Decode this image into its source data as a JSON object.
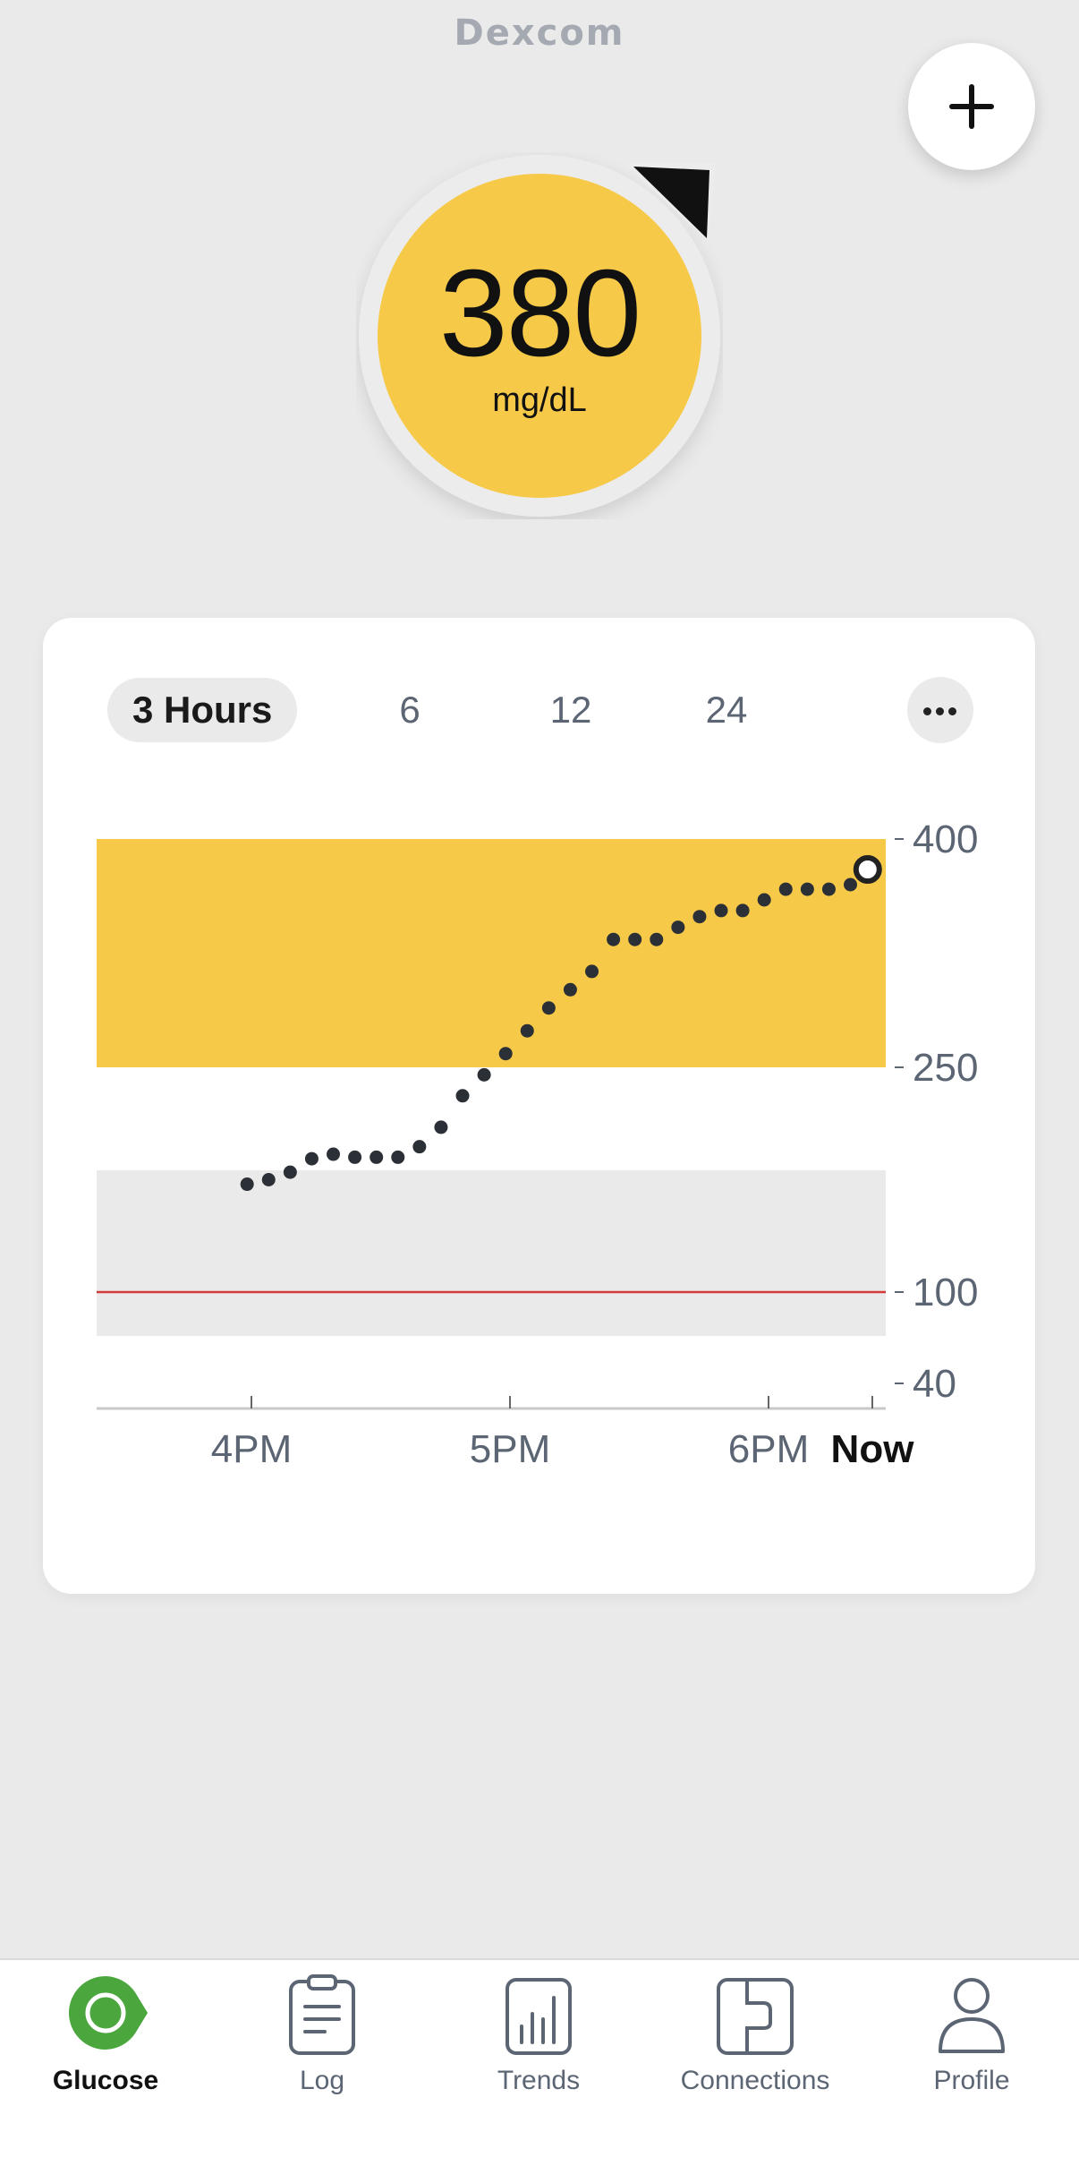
{
  "header": {
    "logo": "Dexcom",
    "add_button": "plus-icon"
  },
  "glucose": {
    "value": "380",
    "unit": "mg/dL",
    "status_color": "#f6c948",
    "trend": "rising-arrow"
  },
  "range_tabs": [
    "3 Hours",
    "6",
    "12",
    "24"
  ],
  "active_range": "3 Hours",
  "more_button": "more-icon",
  "chart_data": {
    "type": "scatter",
    "x_labels": [
      "4PM",
      "5PM",
      "6PM",
      "Now"
    ],
    "y_ticks": [
      "400",
      "250",
      "100",
      "40"
    ],
    "high_band": {
      "from": 250,
      "to": 400,
      "color": "#f6c948"
    },
    "target_band": {
      "from": 70,
      "to": 180,
      "color": "#ebeaea"
    },
    "low_line": {
      "value": 100,
      "color": "#d33a3a"
    },
    "points_minutes_from_4pm": [
      0,
      5,
      10,
      15,
      20,
      25,
      30,
      35,
      40,
      45,
      50,
      55,
      60,
      65,
      70,
      75,
      80,
      85,
      90,
      95,
      100,
      105,
      110,
      115,
      120,
      125,
      130,
      135,
      140,
      145
    ],
    "points": [
      [
        -1,
        172
      ],
      [
        4,
        175
      ],
      [
        9,
        180
      ],
      [
        14,
        189
      ],
      [
        19,
        192
      ],
      [
        24,
        190
      ],
      [
        29,
        190
      ],
      [
        34,
        190
      ],
      [
        39,
        197
      ],
      [
        44,
        210
      ],
      [
        49,
        231
      ],
      [
        54,
        245
      ],
      [
        59,
        259
      ],
      [
        64,
        274
      ],
      [
        69,
        289
      ],
      [
        74,
        301
      ],
      [
        79,
        313
      ],
      [
        84,
        334
      ],
      [
        89,
        334
      ],
      [
        94,
        334
      ],
      [
        99,
        342
      ],
      [
        104,
        349
      ],
      [
        109,
        353
      ],
      [
        114,
        353
      ],
      [
        119,
        360
      ],
      [
        124,
        367
      ],
      [
        129,
        367
      ],
      [
        134,
        367
      ],
      [
        139,
        370
      ],
      [
        143,
        380
      ]
    ]
  },
  "nav": [
    {
      "label": "Glucose",
      "icon": "glucose-icon",
      "active": true
    },
    {
      "label": "Log",
      "icon": "clipboard-icon",
      "active": false
    },
    {
      "label": "Trends",
      "icon": "bar-chart-icon",
      "active": false
    },
    {
      "label": "Connections",
      "icon": "connections-icon",
      "active": false
    },
    {
      "label": "Profile",
      "icon": "person-icon",
      "active": false
    }
  ]
}
